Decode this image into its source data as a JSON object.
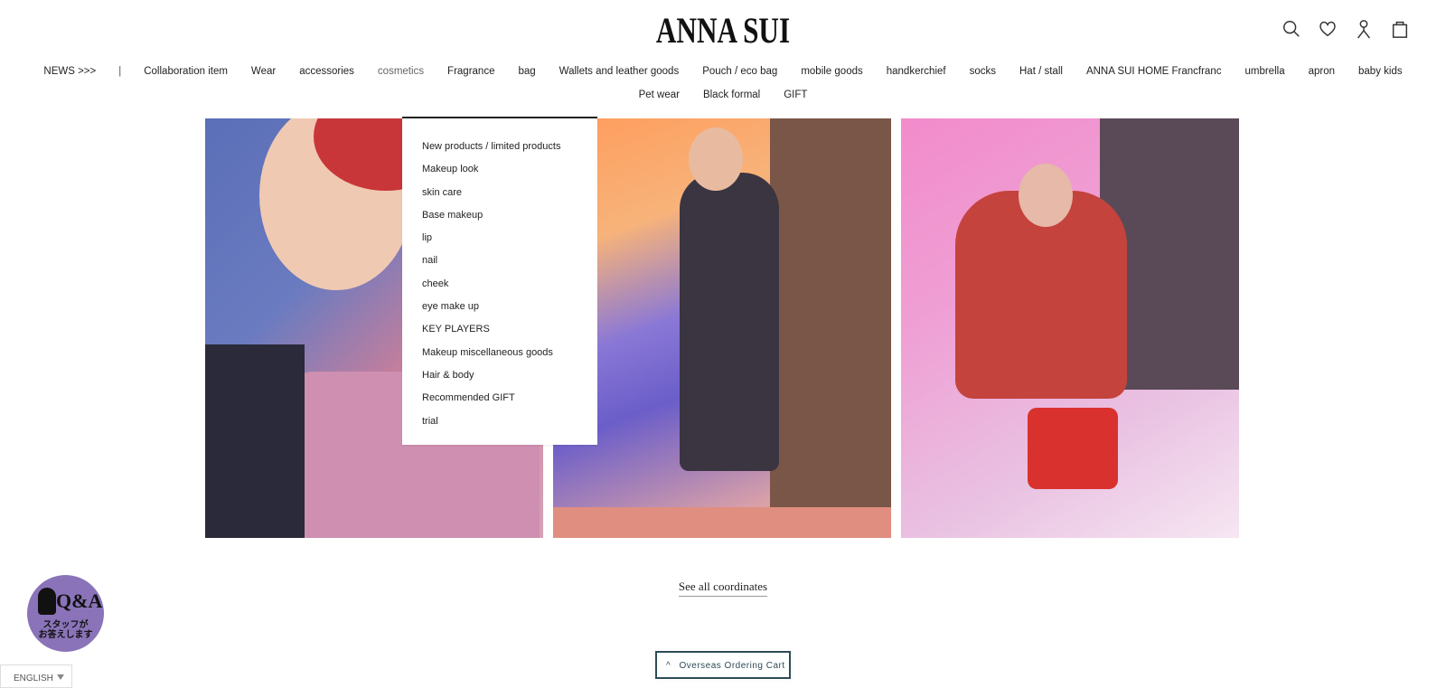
{
  "brand": {
    "logo": "ANNA SUI"
  },
  "header_icons": [
    "search-icon",
    "heart-icon",
    "user-icon",
    "bag-icon"
  ],
  "nav": {
    "row1": [
      "NEWS >>>",
      "Collaboration item",
      "Wear",
      "accessories",
      "cosmetics",
      "Fragrance",
      "bag",
      "Wallets and leather goods",
      "Pouch / eco bag",
      "mobile goods",
      "handkerchief",
      "socks",
      "Hat / stall",
      "ANNA SUI HOME Francfranc",
      "umbrella",
      "apron",
      "baby kids"
    ],
    "row2": [
      "Pet wear",
      "Black formal",
      "GIFT"
    ],
    "active": "cosmetics"
  },
  "dropdown": {
    "items": [
      "New products / limited products",
      "Makeup look",
      "skin care",
      "Base makeup",
      "lip",
      "nail",
      "cheek",
      "eye make up",
      "KEY PLAYERS",
      "Makeup miscellaneous goods",
      "Hair & body",
      "Recommended GIFT",
      "trial"
    ]
  },
  "see_all": "See all coordinates",
  "qa": {
    "title": "Q&A",
    "sub1": "スタッフが",
    "sub2": "お答えします"
  },
  "language": "ENGLISH",
  "cart": {
    "label": "Overseas Ordering Cart"
  },
  "colors": {
    "accent": "#2d4b55",
    "qa_bg": "#8a73b8"
  }
}
